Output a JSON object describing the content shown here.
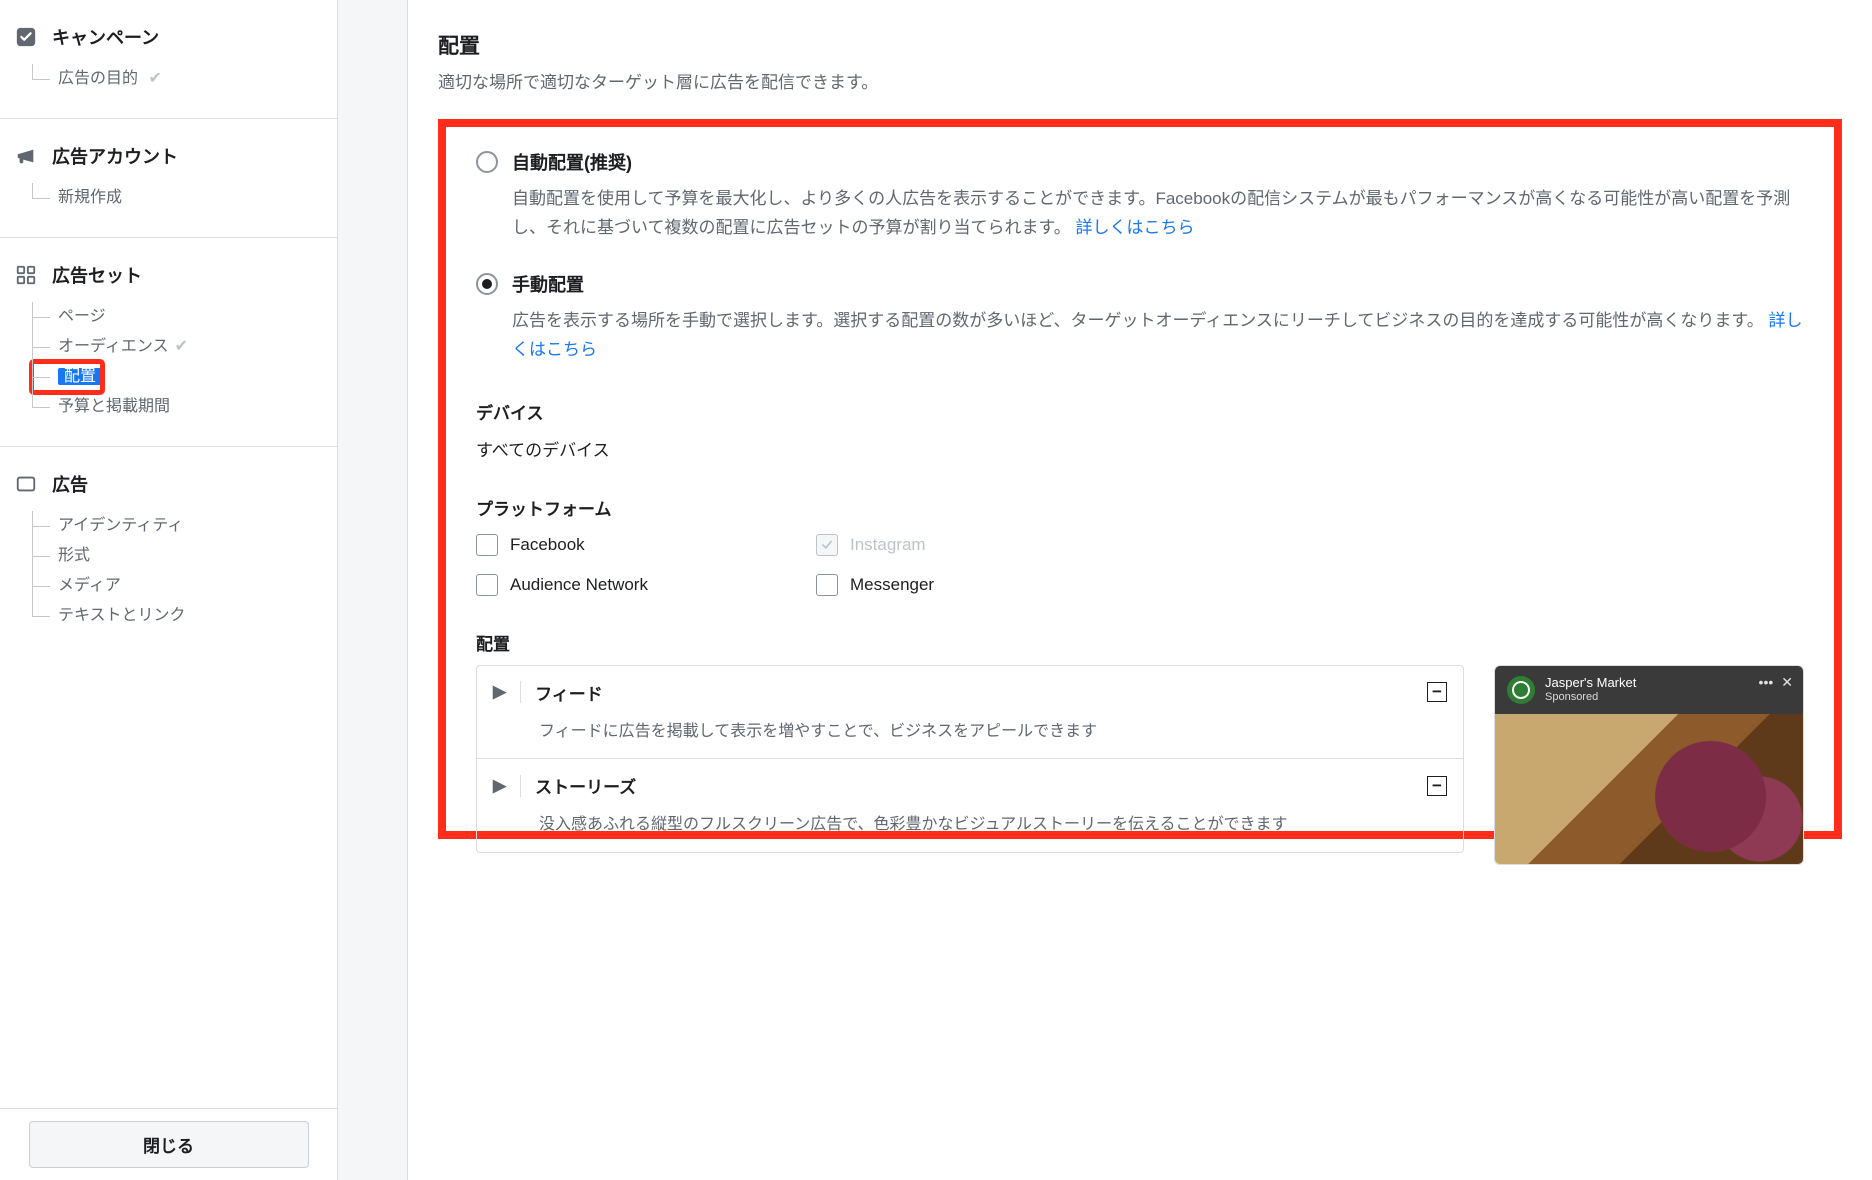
{
  "sidebar": {
    "campaign": {
      "title": "キャンペーン",
      "items": [
        "広告の目的"
      ]
    },
    "account": {
      "title": "広告アカウント",
      "items": [
        "新規作成"
      ]
    },
    "adset": {
      "title": "広告セット",
      "items": [
        "ページ",
        "オーディエンス",
        "配置",
        "予算と掲載期間"
      ],
      "active_index": 2
    },
    "ad": {
      "title": "広告",
      "items": [
        "アイデンティティ",
        "形式",
        "メディア",
        "テキストとリンク"
      ]
    },
    "close_label": "閉じる"
  },
  "main": {
    "title": "配置",
    "subtitle": "適切な場所で適切なターゲット層に広告を配信できます。",
    "auto": {
      "label": "自動配置(推奨)",
      "desc_a": "自動配置を使用して予算を最大化し、より多くの人広告を表示することができます。Facebookの配信システムが最もパフォーマンスが高くなる可能性が高い配置を予測し、それに基づいて複数の配置に広告セットの予算が割り当てられます。",
      "link": "詳しくはこちら"
    },
    "manual": {
      "label": "手動配置",
      "desc_a": "広告を表示する場所を手動で選択します。選択する配置の数が多いほど、ターゲットオーディエンスにリーチしてビジネスの目的を達成する可能性が高くなります。",
      "link": "詳しくはこちら"
    },
    "device_h": "デバイス",
    "device_v": "すべてのデバイス",
    "platform_h": "プラットフォーム",
    "platforms": [
      "Facebook",
      "Instagram",
      "Audience Network",
      "Messenger"
    ],
    "placements_h": "配置",
    "acc": [
      {
        "title": "フィード",
        "body": "フィードに広告を掲載して表示を増やすことで、ビジネスをアピールできます"
      },
      {
        "title": "ストーリーズ",
        "body": "没入感あふれる縦型のフルスクリーン広告で、色彩豊かなビジュアルストーリーを伝えることができます"
      }
    ],
    "preview": {
      "name": "Jasper's Market",
      "sponsored": "Sponsored"
    }
  }
}
